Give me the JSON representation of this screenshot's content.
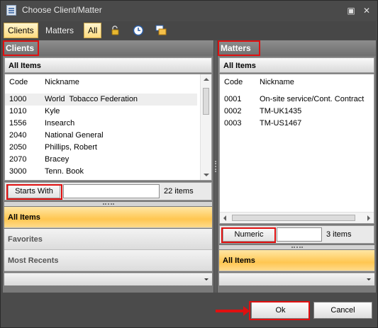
{
  "window": {
    "title": "Choose Client/Matter",
    "icon": "document-list-icon"
  },
  "toolbar": {
    "clients_label": "Clients",
    "matters_label": "Matters",
    "all_label": "All",
    "icons": [
      "padlock-icon",
      "clock-icon",
      "stacked-windows-icon"
    ]
  },
  "clients": {
    "header": "Clients",
    "section": "All Items",
    "columns": [
      "Code",
      "Nickname"
    ],
    "rows": [
      [
        "1000",
        "World  Tobacco Federation"
      ],
      [
        "1010",
        "Kyle"
      ],
      [
        "1556",
        "Insearch"
      ],
      [
        "2040",
        "National General"
      ],
      [
        "2050",
        "Phillips, Robert"
      ],
      [
        "2070",
        "Bracey"
      ],
      [
        "3000",
        "Tenn. Book"
      ]
    ],
    "filter_button": "Starts With",
    "filter_value": "",
    "count": "22 items",
    "nav": [
      "All Items",
      "Favorites",
      "Most Recents"
    ]
  },
  "matters": {
    "header": "Matters",
    "section": "All Items",
    "columns": [
      "Code",
      "Nickname"
    ],
    "rows": [
      [
        "0001",
        "On-site service/Cont. Contract"
      ],
      [
        "0002",
        "TM-UK1435"
      ],
      [
        "0003",
        "TM-US1467"
      ]
    ],
    "filter_button": "Numeric",
    "filter_value": "",
    "count": "3 items",
    "nav": [
      "All Items"
    ]
  },
  "buttons": {
    "ok": "Ok",
    "cancel": "Cancel"
  },
  "colors": {
    "highlight": "#e01010",
    "active_nav": "#ffc651"
  }
}
